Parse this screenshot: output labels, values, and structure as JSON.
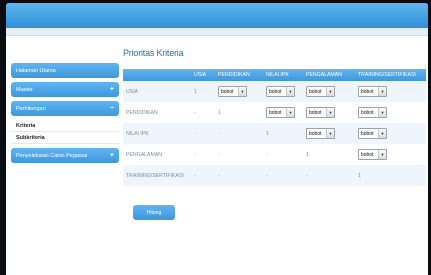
{
  "sidebar": {
    "items": [
      {
        "label": "Halaman Utama",
        "sign": ""
      },
      {
        "label": "Master",
        "sign": "+"
      },
      {
        "label": "Perhitungan",
        "sign": "−"
      }
    ],
    "subitems": [
      "Kriteria",
      "Subkriteria"
    ],
    "last": {
      "label": "Penyeleksian Calon Pegawai",
      "sign": "+"
    }
  },
  "main": {
    "title": "Prioritas Kriteria",
    "columns": [
      "",
      "USIA",
      "PENDIDIKAN",
      "NILAI IPK",
      "PENGALAMAN",
      "TRAINING/SERTIFIKASI"
    ],
    "rows": [
      {
        "label": "USIA",
        "cells": [
          "1",
          "bobot",
          "bobot",
          "bobot",
          "bobot"
        ]
      },
      {
        "label": "PENDIDIKAN",
        "cells": [
          "-",
          "1",
          "bobot",
          "bobot",
          "bobot"
        ]
      },
      {
        "label": "NILAI IPK",
        "cells": [
          "-",
          "-",
          "1",
          "bobot",
          "bobot"
        ]
      },
      {
        "label": "PENGALAMAN",
        "cells": [
          "-",
          "-",
          "-",
          "1",
          "bobot"
        ]
      },
      {
        "label": "TRAINING/SERTIFIKASI",
        "cells": [
          "-",
          "-",
          "-",
          "-",
          "1"
        ]
      }
    ],
    "button_label": "Hitung"
  },
  "colors": {
    "accent": "#3d98dd",
    "title": "#2a6fae"
  }
}
